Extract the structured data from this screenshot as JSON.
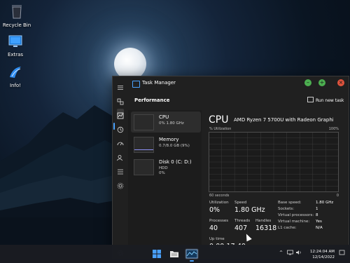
{
  "desktop": {
    "icons": [
      {
        "label": "Recycle Bin",
        "icon": "recycle-bin-icon"
      },
      {
        "label": "Extras",
        "icon": "extras-icon"
      },
      {
        "label": "Info!",
        "icon": "info-icon"
      }
    ]
  },
  "window": {
    "title": "Task Manager",
    "controls": {
      "minimize": "–",
      "maximize": "+",
      "close": "×"
    }
  },
  "header": {
    "page_title": "Performance",
    "run_new_task": "Run new task",
    "more": "···"
  },
  "resources": [
    {
      "name": "CPU",
      "detail": "0% 1.80 GHz"
    },
    {
      "name": "Memory",
      "detail": "0.7/8.0 GB (9%)"
    },
    {
      "name": "Disk 0 (C: D:)",
      "detail": "HDD",
      "detail2": "0%"
    }
  ],
  "cpu": {
    "title": "CPU",
    "model": "AMD Ryzen 7 5700U with Radeon Graphi...",
    "axis_label": "% Utilization",
    "axis_max": "100%",
    "time_left": "60 seconds",
    "time_right": "0",
    "utilization_label": "Utilization",
    "utilization": "0%",
    "speed_label": "Speed",
    "speed": "1.80 GHz",
    "processes_label": "Processes",
    "processes": "40",
    "threads_label": "Threads",
    "threads": "407",
    "handles_label": "Handles",
    "handles": "16318",
    "uptime_label": "Up time",
    "uptime": "0:00:17:40",
    "specs": [
      {
        "key": "Base speed:",
        "value": "1.80 GHz"
      },
      {
        "key": "Sockets:",
        "value": "1"
      },
      {
        "key": "Virtual processors:",
        "value": "8"
      },
      {
        "key": "Virtual machine:",
        "value": "Yes"
      },
      {
        "key": "L1 cache:",
        "value": "N/A"
      }
    ]
  },
  "taskbar": {
    "time": "12:24:04 AM",
    "date": "12/14/2022",
    "tray_caret": "^"
  },
  "colors": {
    "accent": "#4aa3ff",
    "window_bg": "#202020",
    "graph_grid": "#3b3b3b"
  }
}
